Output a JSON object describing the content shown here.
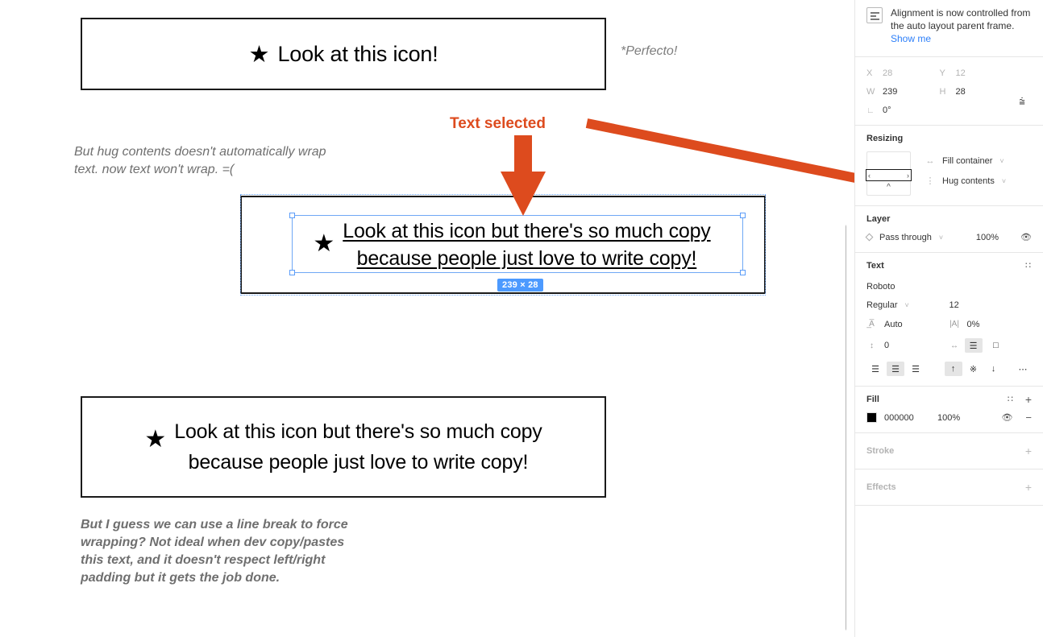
{
  "canvas": {
    "box1": {
      "icon": "star-icon",
      "label": "Look at this icon!"
    },
    "perfecto_note": "*Perfecto!",
    "hug_note": "But hug contents doesn't automatically wrap\ntext. now text won't wrap. =(",
    "box2": {
      "icon": "star-icon",
      "label": "Look at this icon but there's so much copy\nbecause people just love to write copy!",
      "dimension_badge": "239 × 28"
    },
    "box3": {
      "icon": "star-icon",
      "label": "Look at this icon but there's so much copy\nbecause people just love to write copy!"
    },
    "break_note": "But I guess we can use a line break to force\nwrapping? Not ideal when dev copy/pastes\nthis text, and it doesn't respect left/right\npadding but it gets the job done.",
    "annotation": {
      "label": "Text selected",
      "color": "#dd4b1e"
    }
  },
  "panel": {
    "hint": {
      "icon": "align-left-icon",
      "text": "Alignment is now controlled from the auto layout parent frame. ",
      "link": "Show me"
    },
    "position": {
      "x_label": "X",
      "x_value": "28",
      "y_label": "Y",
      "y_value": "12",
      "w_label": "W",
      "w_value": "239",
      "h_label": "H",
      "h_value": "28",
      "rotation_value": "0°"
    },
    "resizing": {
      "title": "Resizing",
      "horizontal": "Fill container",
      "vertical": "Hug contents"
    },
    "layer": {
      "title": "Layer",
      "blend_mode": "Pass through",
      "opacity": "100%"
    },
    "text": {
      "title": "Text",
      "font_family": "Roboto",
      "font_weight": "Regular",
      "font_size": "12",
      "line_height": "Auto",
      "letter_spacing": "0%",
      "paragraph_spacing": "0",
      "align_horizontal": "center",
      "align_vertical": "top"
    },
    "fill": {
      "title": "Fill",
      "hex": "000000",
      "opacity": "100%",
      "color": "#000000"
    },
    "stroke": {
      "title": "Stroke"
    },
    "effects": {
      "title": "Effects"
    }
  }
}
